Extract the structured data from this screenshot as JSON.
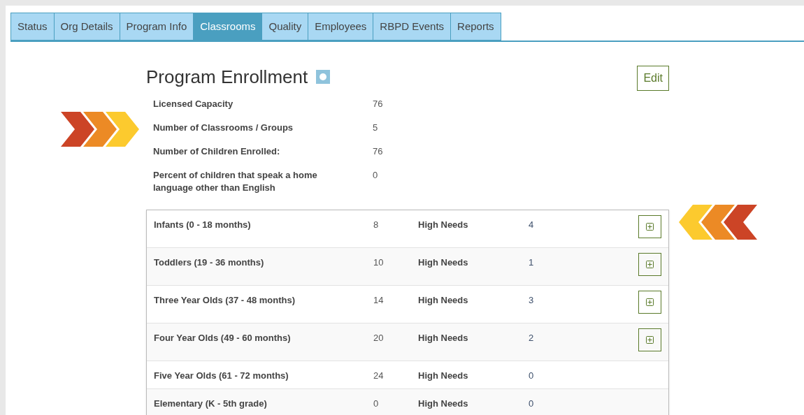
{
  "tabs": [
    {
      "label": "Status",
      "selected": false
    },
    {
      "label": "Org Details",
      "selected": false
    },
    {
      "label": "Program Info",
      "selected": false
    },
    {
      "label": "Classrooms",
      "selected": true
    },
    {
      "label": "Quality",
      "selected": false
    },
    {
      "label": "Employees",
      "selected": false
    },
    {
      "label": "RBPD Events",
      "selected": false
    },
    {
      "label": "Reports",
      "selected": false
    }
  ],
  "title": "Program Enrollment",
  "edit_button": "Edit",
  "summary": [
    {
      "label": "Licensed Capacity",
      "value": "76"
    },
    {
      "label": "Number of Classrooms / Groups",
      "value": "5"
    },
    {
      "label": "Number of Children Enrolled:",
      "value": "76"
    },
    {
      "label": "Percent of children that speak a home language other than English",
      "value": "0"
    }
  ],
  "age_groups": [
    {
      "kind": "expandable",
      "name": "Infants (0 - 18 months)",
      "count": "8",
      "needs_label": "High Needs",
      "needs": "4"
    },
    {
      "kind": "expandable",
      "name": "Toddlers (19 - 36 months)",
      "count": "10",
      "needs_label": "High Needs",
      "needs": "1"
    },
    {
      "kind": "expandable",
      "name": "Three Year Olds (37 - 48 months)",
      "count": "14",
      "needs_label": "High Needs",
      "needs": "3"
    },
    {
      "kind": "expandable",
      "name": "Four Year Olds (49 - 60 months)",
      "count": "20",
      "needs_label": "High Needs",
      "needs": "2"
    },
    {
      "kind": "plain",
      "name": "Five Year Olds (61 - 72 months)",
      "count": "24",
      "needs_label": "High Needs",
      "needs": "0"
    },
    {
      "kind": "plain",
      "name": "Elementary (K - 5th grade)",
      "count": "0",
      "needs_label": "High Needs",
      "needs": "0"
    }
  ]
}
